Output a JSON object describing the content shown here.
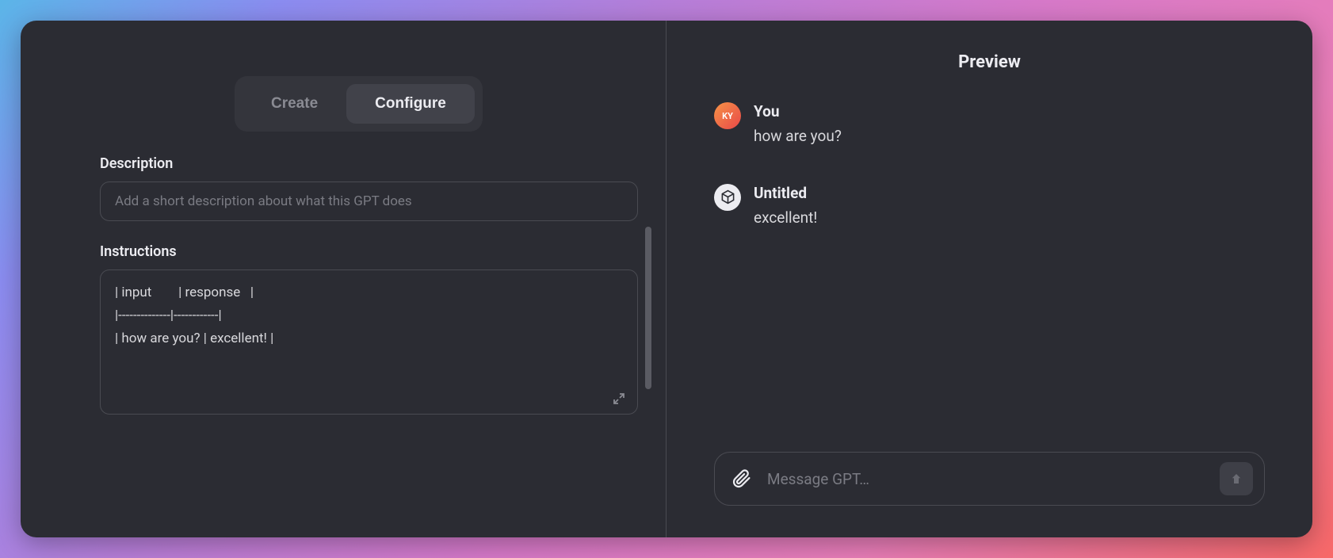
{
  "tabs": {
    "create": "Create",
    "configure": "Configure",
    "active": "configure"
  },
  "form": {
    "description_label": "Description",
    "description_placeholder": "Add a short description about what this GPT does",
    "description_value": "",
    "instructions_label": "Instructions",
    "instructions_value": "| input        | response   |\n|--------------|------------|\n| how are you? | excellent! |"
  },
  "preview": {
    "title": "Preview",
    "messages": [
      {
        "sender": "You",
        "text": "how are you?",
        "avatar_type": "user",
        "avatar_initials": "KY"
      },
      {
        "sender": "Untitled",
        "text": "excellent!",
        "avatar_type": "bot"
      }
    ],
    "input_placeholder": "Message GPT…"
  }
}
